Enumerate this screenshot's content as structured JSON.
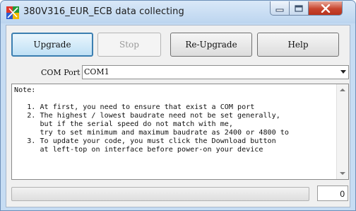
{
  "window": {
    "title": "380V316_EUR_ECB data collecting",
    "icons": {
      "app": "app-icon",
      "minimize": "minimize-icon",
      "maximize": "maximize-icon",
      "close": "close-icon"
    }
  },
  "toolbar": {
    "upgrade_label": "Upgrade",
    "stop_label": "Stop",
    "reupgrade_label": "Re-Upgrade",
    "help_label": "Help"
  },
  "com_port": {
    "label": "COM Port",
    "selected": "COM1"
  },
  "notes": {
    "text": "Note:\n\n   1. At first, you need to ensure that exist a COM port\n   2. The highest / lowest baudrate need not be set generally,\n      but if the serial speed do not match with me,\n      try to set minimum and maximum baudrate as 2400 or 4800 to\n   3. To update your code, you must click the Download button\n      at left-top on interface before power-on your device"
  },
  "status": {
    "progress_fraction": 0,
    "count": "0"
  },
  "colors": {
    "title_bg": "#c6dcf3",
    "default_button_border": "#3c7fb1",
    "close_button": "#c8452e"
  }
}
